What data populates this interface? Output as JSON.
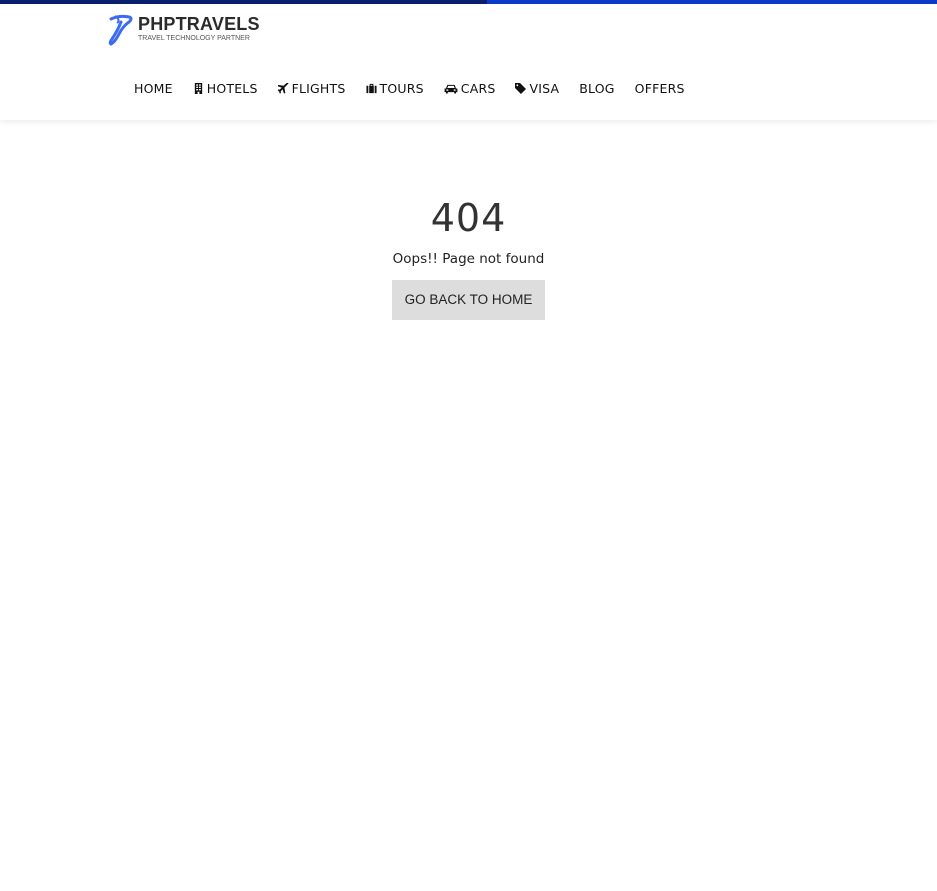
{
  "progress": {
    "percent": 52,
    "colors": {
      "done": "#0a1f6e",
      "remaining": "#0a3ac9"
    }
  },
  "logo": {
    "name": "PHPTRAVELS",
    "tagline": "TRAVEL TECHNOLOGY PARTNER",
    "color": "#3d6bf0"
  },
  "nav": {
    "items": [
      {
        "label": "HOME",
        "icon": ""
      },
      {
        "label": "HOTELS",
        "icon": "building-icon"
      },
      {
        "label": "FLIGHTS",
        "icon": "plane-icon"
      },
      {
        "label": "TOURS",
        "icon": "suitcase-icon"
      },
      {
        "label": "CARS",
        "icon": "car-icon"
      },
      {
        "label": "VISA",
        "icon": "tag-icon"
      },
      {
        "label": "BLOG",
        "icon": ""
      },
      {
        "label": "OFFERS",
        "icon": ""
      }
    ]
  },
  "error": {
    "code": "404",
    "message": "Oops!! Page not found",
    "button": "GO BACK TO HOME"
  }
}
